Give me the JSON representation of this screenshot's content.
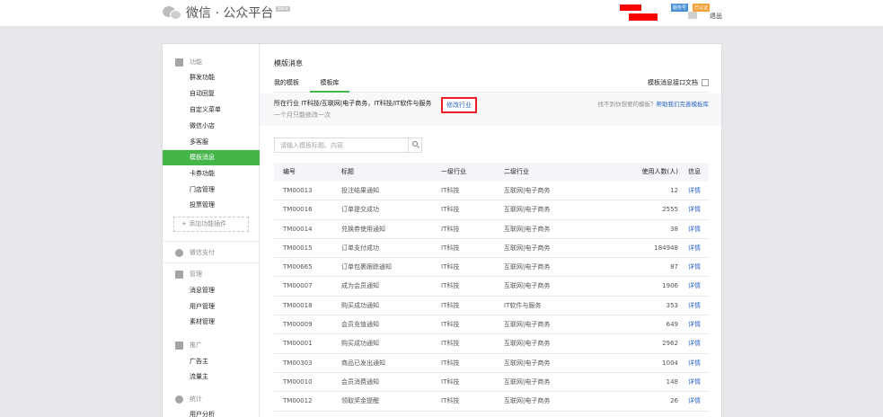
{
  "header": {
    "brand_name": "微信 · 公众平台",
    "beta_badge": "beta",
    "service_badge": "服务号",
    "verified_badge": "已认证",
    "logout_label": "退出"
  },
  "sidebar": {
    "groups": [
      {
        "label": "功能",
        "icon": "grid-icon"
      },
      {
        "label": "微信支付",
        "icon": "wechat-pay-icon"
      },
      {
        "label": "管理",
        "icon": "manage-icon"
      },
      {
        "label": "推广",
        "icon": "megaphone-icon"
      },
      {
        "label": "统计",
        "icon": "pie-chart-icon"
      }
    ],
    "items": [
      {
        "label": "群发功能"
      },
      {
        "label": "自动回复"
      },
      {
        "label": "自定义菜单"
      },
      {
        "label": "微信小店"
      },
      {
        "label": "多客服"
      },
      {
        "label": "模板消息",
        "active": true
      },
      {
        "label": "卡券功能"
      },
      {
        "label": "门店管理"
      },
      {
        "label": "投票管理"
      },
      {
        "label": "消息管理"
      },
      {
        "label": "用户管理"
      },
      {
        "label": "素材管理"
      },
      {
        "label": "广告主"
      },
      {
        "label": "流量主"
      },
      {
        "label": "用户分析"
      }
    ],
    "add_plugin_label": "+ 添加功能插件"
  },
  "main": {
    "title": "模版消息",
    "tabs": [
      {
        "label": "我的模板"
      },
      {
        "label": "模板库",
        "active": true
      }
    ],
    "doc_link": "模板消息接口文档",
    "industry": {
      "label": "所在行业   IT科技/互联网|电子商务，IT科技/IT软件与服务",
      "modify_button": "修改行业",
      "note": "一个月只能修改一次",
      "help_text": "找不到你想要的模板？",
      "help_link": "帮助我们完善模板库"
    },
    "search": {
      "placeholder": "请输入模板标题、内容"
    },
    "table": {
      "columns": [
        "编号",
        "标题",
        "一级行业",
        "二级行业",
        "使用人数(人)",
        "信息"
      ],
      "rows": [
        {
          "id": "TM00013",
          "title": "投注结果通知",
          "l1": "IT科技",
          "l2": "互联网|电子商务",
          "users": "12",
          "info": "详情"
        },
        {
          "id": "TM00016",
          "title": "订单提交成功",
          "l1": "IT科技",
          "l2": "互联网|电子商务",
          "users": "2555",
          "info": "详情"
        },
        {
          "id": "TM00014",
          "title": "兑换券使用通知",
          "l1": "IT科技",
          "l2": "互联网|电子商务",
          "users": "38",
          "info": "详情"
        },
        {
          "id": "TM00015",
          "title": "订单支付成功",
          "l1": "IT科技",
          "l2": "互联网|电子商务",
          "users": "184948",
          "info": "详情"
        },
        {
          "id": "TM00665",
          "title": "订单包裹跟踪通知",
          "l1": "IT科技",
          "l2": "互联网|电子商务",
          "users": "87",
          "info": "详情"
        },
        {
          "id": "TM00007",
          "title": "成为会员通知",
          "l1": "IT科技",
          "l2": "互联网|电子商务",
          "users": "1906",
          "info": "详情"
        },
        {
          "id": "TM00018",
          "title": "购买成功通知",
          "l1": "IT科技",
          "l2": "IT软件与服务",
          "users": "353",
          "info": "详情"
        },
        {
          "id": "TM00009",
          "title": "会员充值通知",
          "l1": "IT科技",
          "l2": "互联网|电子商务",
          "users": "649",
          "info": "详情"
        },
        {
          "id": "TM00001",
          "title": "购买成功通知",
          "l1": "IT科技",
          "l2": "互联网|电子商务",
          "users": "2962",
          "info": "详情"
        },
        {
          "id": "TM00303",
          "title": "商品已发出通知",
          "l1": "IT科技",
          "l2": "互联网|电子商务",
          "users": "1004",
          "info": "详情"
        },
        {
          "id": "TM00010",
          "title": "会员消费通知",
          "l1": "IT科技",
          "l2": "互联网|电子商务",
          "users": "148",
          "info": "详情"
        },
        {
          "id": "TM00012",
          "title": "领取奖金提醒",
          "l1": "IT科技",
          "l2": "互联网|电子商务",
          "users": "26",
          "info": "详情"
        }
      ]
    }
  },
  "colors": {
    "accent_green": "#44b549",
    "link_blue": "#2b66c9",
    "highlight_red": "#ee1c24"
  }
}
